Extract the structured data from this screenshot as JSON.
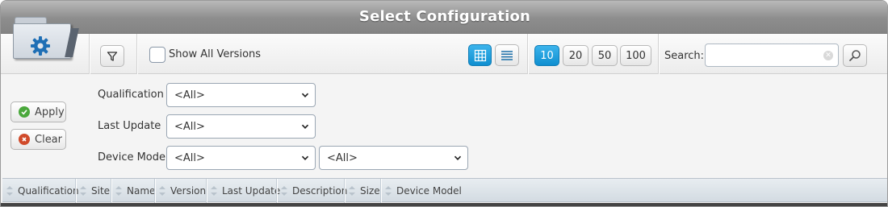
{
  "window": {
    "title": "Select Configuration"
  },
  "toolbar": {
    "show_all_versions_label": "Show All Versions",
    "show_all_versions_checked": false,
    "page_sizes": [
      "10",
      "20",
      "50",
      "100"
    ],
    "selected_page_size": "10",
    "search_label": "Search:",
    "search_value": "",
    "view_mode": "grid",
    "accent_color": "#1a9ad9"
  },
  "filters": {
    "qualification": {
      "label": "Qualification",
      "value": "<All>"
    },
    "last_update": {
      "label": "Last Update",
      "value": "<All>"
    },
    "device_model": {
      "label": "Device Model",
      "value": "<All>",
      "value2": "<All>"
    }
  },
  "actions": {
    "apply_label": "Apply",
    "clear_label": "Clear"
  },
  "table": {
    "columns": [
      "Qualification",
      "Site",
      "Name",
      "Version",
      "Last Update",
      "Description",
      "Size",
      "Device Model"
    ]
  }
}
